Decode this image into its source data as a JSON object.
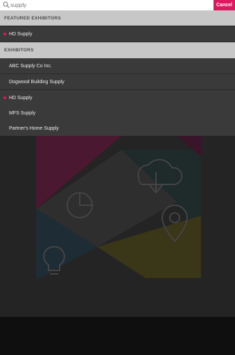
{
  "search": {
    "value": "supply",
    "cancel_label": "Cancel"
  },
  "featured": {
    "header": "FEATURED EXHIBITORS",
    "items": [
      {
        "label": "HD Supply",
        "dot": true
      }
    ]
  },
  "exhibitors": {
    "header": "EXHIBITORS",
    "items": [
      {
        "label": "ABC Supply Co Inc.",
        "dot": false
      },
      {
        "label": "Dogwood Building Supply",
        "dot": false
      },
      {
        "label": "HD Supply",
        "dot": true
      },
      {
        "label": "MFS Supply",
        "dot": false
      },
      {
        "label": "Partner's Home Supply",
        "dot": false
      }
    ]
  },
  "colors": {
    "accent": "#e0185f",
    "header_bg": "#c7c7c7",
    "row_bg": "#3a3a3a"
  }
}
